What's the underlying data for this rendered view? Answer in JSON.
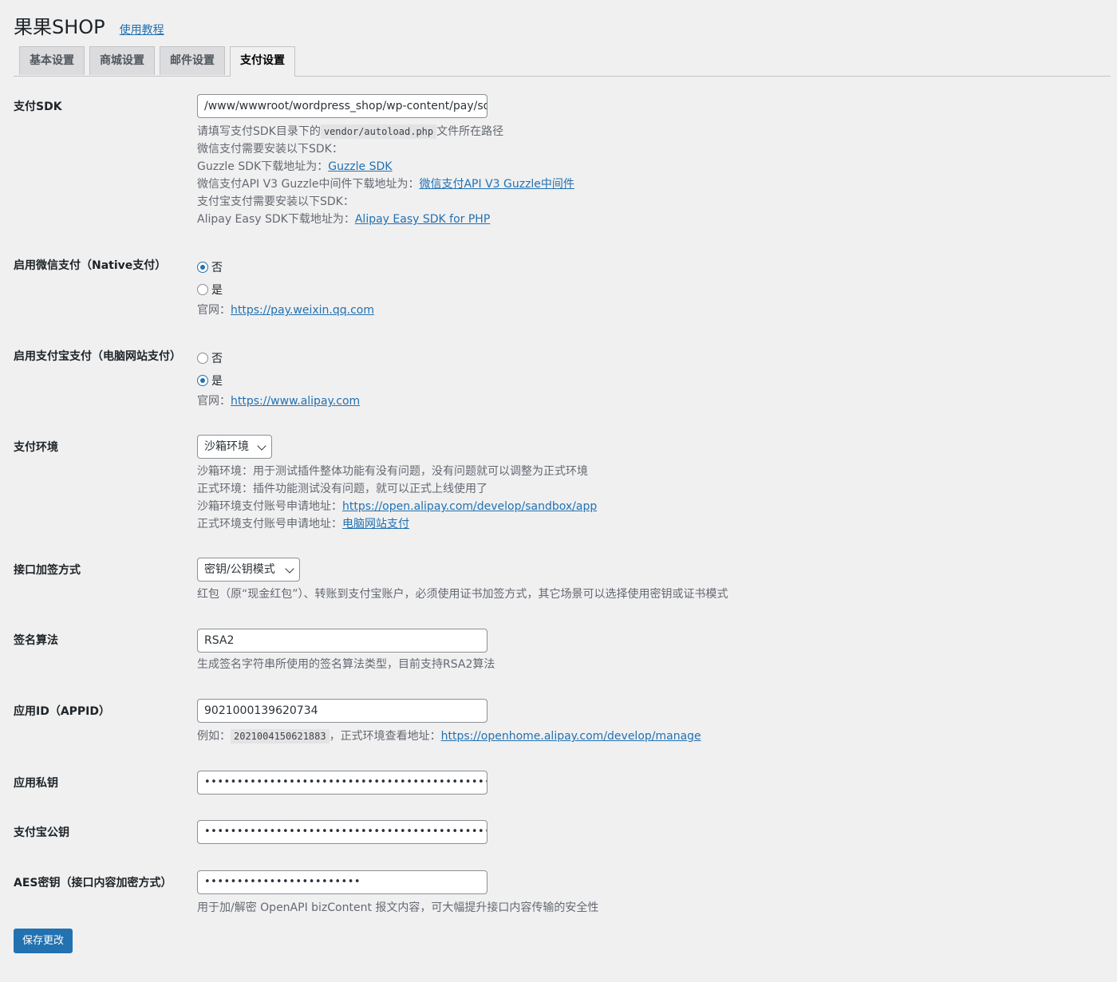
{
  "header": {
    "title": "果果SHOP",
    "help_link": "使用教程"
  },
  "tabs": [
    {
      "label": "基本设置"
    },
    {
      "label": "商城设置"
    },
    {
      "label": "邮件设置"
    },
    {
      "label": "支付设置",
      "active": true
    }
  ],
  "sdk": {
    "label": "支付SDK",
    "value": "/www/wwwroot/wordpress_shop/wp-content/pay/sdk",
    "desc1_pre": "请填写支付SDK目录下的",
    "desc1_code": "vendor/autoload.php",
    "desc1_post": "文件所在路径",
    "desc2": "微信支付需要安装以下SDK：",
    "desc3_pre": "Guzzle SDK下载地址为：",
    "desc3_link": "Guzzle SDK",
    "desc4_pre": "微信支付API V3 Guzzle中间件下载地址为：",
    "desc4_link": "微信支付API V3 Guzzle中间件",
    "desc5": "支付宝支付需要安装以下SDK：",
    "desc6_pre": "Alipay Easy SDK下载地址为：",
    "desc6_link": "Alipay Easy SDK for PHP"
  },
  "wechat": {
    "label": "启用微信支付（Native支付）",
    "option_no": "否",
    "option_yes": "是",
    "selected": "否",
    "site_pre": "官网：",
    "site_link": "https://pay.weixin.qq.com"
  },
  "alipay": {
    "label": "启用支付宝支付（电脑网站支付）",
    "option_no": "否",
    "option_yes": "是",
    "selected": "是",
    "site_pre": "官网：",
    "site_link": "https://www.alipay.com"
  },
  "env": {
    "label": "支付环境",
    "selected": "沙箱环境",
    "desc1": "沙箱环境：用于测试插件整体功能有没有问题，没有问题就可以调整为正式环境",
    "desc2": "正式环境：插件功能测试没有问题，就可以正式上线使用了",
    "desc3_pre": "沙箱环境支付账号申请地址：",
    "desc3_link": "https://open.alipay.com/develop/sandbox/app",
    "desc4_pre": "正式环境支付账号申请地址：",
    "desc4_link": "电脑网站支付"
  },
  "sign_mode": {
    "label": "接口加签方式",
    "selected": "密钥/公钥模式",
    "desc": "红包（原“现金红包”）、转账到支付宝账户，必须使用证书加签方式，其它场景可以选择使用密钥或证书模式"
  },
  "sign_algo": {
    "label": "签名算法",
    "value": "RSA2",
    "desc": "生成签名字符串所使用的签名算法类型，目前支持RSA2算法"
  },
  "appid": {
    "label": "应用ID（APPID）",
    "value": "9021000139620734",
    "desc_pre": "例如：",
    "desc_code": "2021004150621883",
    "desc_mid": "，正式环境查看地址：",
    "desc_link": "https://openhome.alipay.com/develop/manage"
  },
  "private_key": {
    "label": "应用私钥",
    "value": "••••••••••••••••••••••••••••••••••••••••••••••••••••••••••"
  },
  "alipay_pubkey": {
    "label": "支付宝公钥",
    "value": "••••••••••••••••••••••••••••••••••••••••••••••••••••••••••"
  },
  "aes_key": {
    "label": "AES密钥（接口内容加密方式）",
    "value": "••••••••••••••••••••••••",
    "desc": "用于加/解密 OpenAPI bizContent 报文内容，可大幅提升接口内容传输的安全性"
  },
  "save_button": "保存更改",
  "colors": {
    "accent": "#2271b1",
    "background": "#f0f0f1",
    "muted_text": "#646970"
  }
}
